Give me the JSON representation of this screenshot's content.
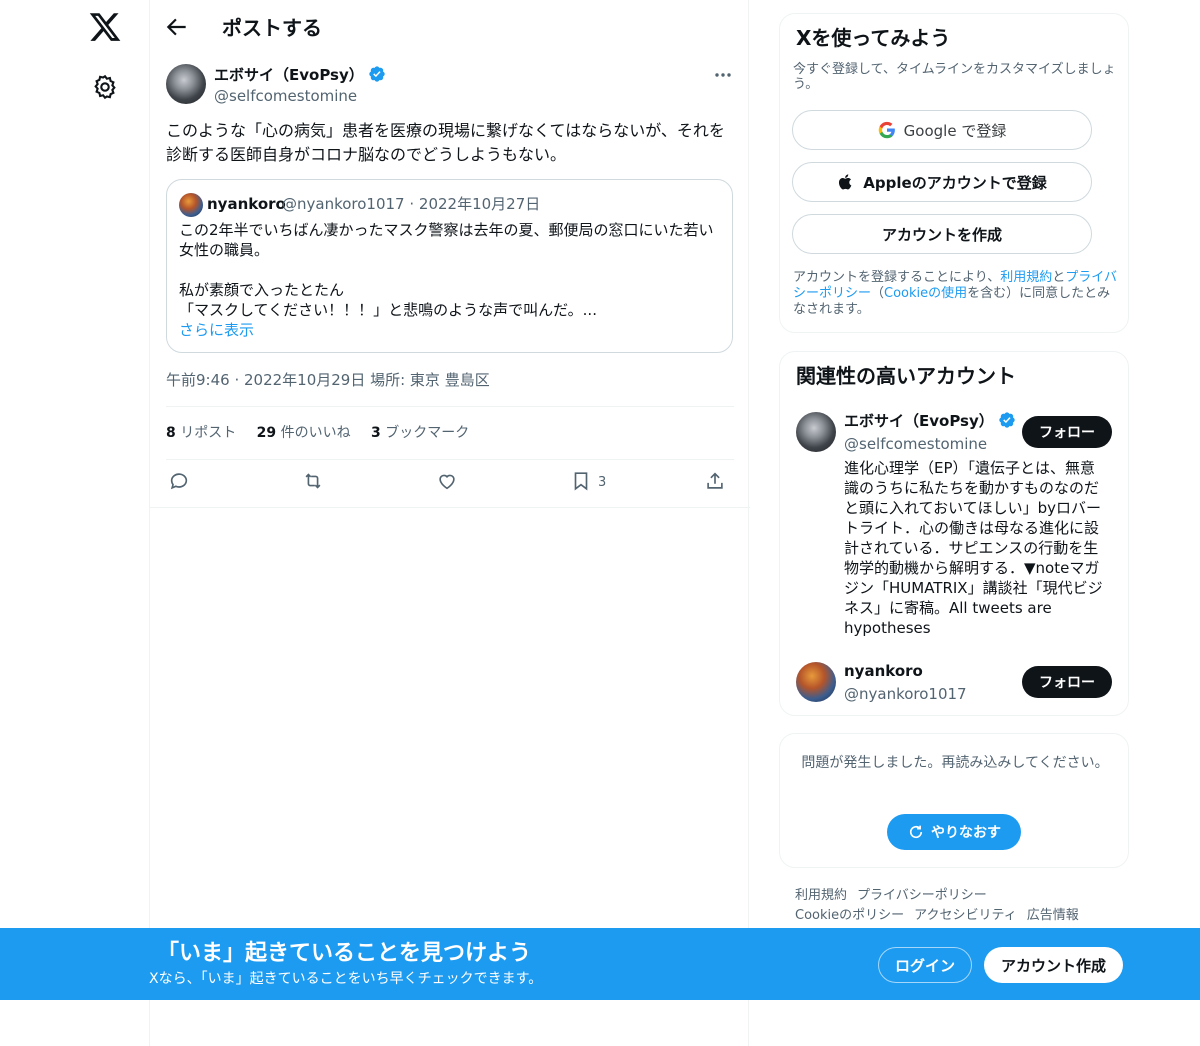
{
  "header": {
    "title": "ポストする"
  },
  "post": {
    "author_name": "エボサイ（EvoPsy）",
    "author_handle": "@selfcomestomine",
    "text": "このような「心の病気」患者を医療の現場に繋げなくてはならないが、それを診断する医師自身がコロナ脳なのでどうしようもない。",
    "quote": {
      "author_name": "nyankoro",
      "author_meta": "@nyankoro1017 · 2022年10月27日",
      "text": "この2年半でいちばん凄かったマスク警察は去年の夏、郵便局の窓口にいた若い女性の職員。\n\n私が素顔で入ったとたん\n「マスクしてください！！！」と悲鳴のような声で叫んだ。...",
      "show_more": "さらに表示"
    },
    "timestamp": "午前9:46 · 2022年10月29日 場所: 東京 豊島区",
    "stats": {
      "reposts_count": "8",
      "reposts_label": "リポスト",
      "likes_count": "29",
      "likes_label": "件のいいね",
      "bookmarks_count": "3",
      "bookmarks_label": "ブックマーク"
    },
    "bookmark_action_count": "3"
  },
  "signup": {
    "title": "Xを使ってみよう",
    "subtitle": "今すぐ登録して、タイムラインをカスタマイズしましょう。",
    "google_label": "Google で登録",
    "apple_label": "Appleのアカウントで登録",
    "create_label": "アカウントを作成",
    "legal_prefix": "アカウントを登録することにより、",
    "legal_terms": "利用規約",
    "legal_and": "と",
    "legal_privacy": "プライバシーポリシー",
    "legal_paren_open": "（",
    "legal_cookie": "Cookieの使用",
    "legal_suffix": "を含む）に同意したとみなされます。"
  },
  "related": {
    "title": "関連性の高いアカウント",
    "accounts": [
      {
        "name": "エボサイ（EvoPsy）",
        "handle": "@selfcomestomine",
        "bio": "進化心理学（EP）「遺伝子とは、無意識のうちに私たちを動かすものなのだと頭に入れておいてほしい」byロバートライト．心の働きは母なる進化に設計されている．サピエンスの行動を生物学的動機から解明する．▼noteマガジン「HUMATRIX」講談社「現代ビジネス」に寄稿。All tweets are hypotheses",
        "follow_label": "フォロー"
      },
      {
        "name": "nyankoro",
        "handle": "@nyankoro1017",
        "follow_label": "フォロー"
      }
    ]
  },
  "error": {
    "message": "問題が発生しました。再読み込みしてください。",
    "retry_label": "やりなおす"
  },
  "footer": {
    "links": [
      "利用規約",
      "プライバシーポリシー",
      "Cookieのポリシー",
      "アクセシビリティ",
      "広告情報"
    ]
  },
  "banner": {
    "title": "「いま」起きていることを見つけよう",
    "subtitle": "Xなら、「いま」起きていることをいち早くチェックできます。",
    "login_label": "ログイン",
    "signup_label": "アカウント作成"
  },
  "colors": {
    "accent": "#1d9bf0",
    "text": "#0f1419",
    "secondary_text": "#536471",
    "border": "#eff3f4"
  }
}
